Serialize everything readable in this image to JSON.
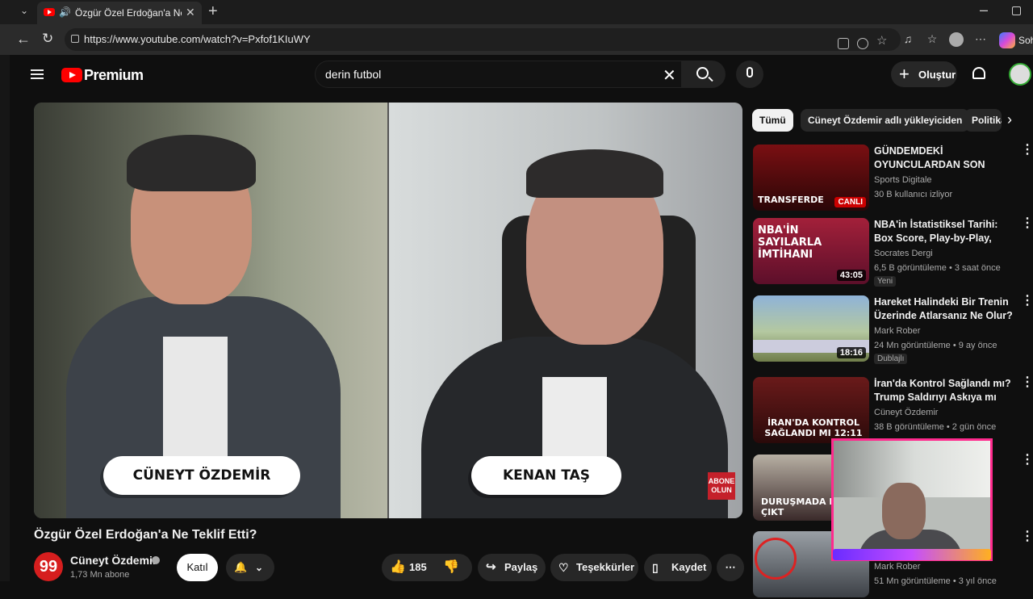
{
  "browser": {
    "tab_title": "Özgür Özel Erdoğan'a Ne Teklif Etti?",
    "url": "https://www.youtube.com/watch?v=Pxfof1KIuWY",
    "copilot_label": "Soh"
  },
  "header": {
    "brand": "Premium",
    "search_value": "derin futbol",
    "create_label": "Oluştur"
  },
  "video": {
    "name_left": "CÜNEYT ÖZDEMİR",
    "name_right": "KENAN TAŞ",
    "abone_badge": "ABONE OLUN",
    "title": "Özgür Özel Erdoğan'a Ne Teklif Etti?",
    "channel": "Cüneyt Özdemir",
    "channel_initial": "99",
    "subscribers": "1,73 Mn abone",
    "join_label": "Katıl",
    "like_count": "185",
    "share_label": "Paylaş",
    "thanks_label": "Teşekkürler",
    "save_label": "Kaydet"
  },
  "chips": [
    "Tümü",
    "Cüneyt Özdemir adlı yükleyiciden",
    "Politika"
  ],
  "recommendations": [
    {
      "title": "GÜNDEMDEKİ OYUNCULARDAN SON HABERLER | CANLI YAYI...",
      "channel": "Sports Digitale",
      "meta": "30 B kullanıcı izliyor",
      "duration": "",
      "live": "CANLI",
      "badge": "",
      "thumb_text": "TRANSFERDE"
    },
    {
      "title": "NBA'in İstatistiksel Tarihi: Box Score, Play-by-Play, Curry'nin ...",
      "channel": "Socrates Dergi",
      "meta": "6,5 B görüntüleme • 3 saat önce",
      "duration": "43:05",
      "live": "",
      "badge": "Yeni",
      "thumb_text": "NBA'İN SAYILARLA İMTİHANI"
    },
    {
      "title": "Hareket Halindeki Bir Trenin Üzerinde Atlarsanız Ne Olur?",
      "channel": "Mark Rober",
      "meta": "24 Mn görüntüleme • 9 ay önce",
      "duration": "18:16",
      "live": "",
      "badge": "Dublajlı",
      "thumb_text": ""
    },
    {
      "title": "İran'da Kontrol Sağlandı mı? Trump Saldırıyı Askıya mı Aldı?",
      "channel": "Cüneyt Özdemir",
      "meta": "38 B görüntüleme • 2 gün önce",
      "duration": "",
      "live": "",
      "badge": "",
      "thumb_text": "İRAN'DA KONTROL SAĞLANDI MI 12:11"
    },
    {
      "title": "",
      "channel": "",
      "meta": "",
      "duration": "",
      "live": "",
      "badge": "",
      "thumb_text": "DURUŞMADA NE ÇIKT"
    },
    {
      "title": "",
      "channel": "Mark Rober",
      "meta": "51 Mn görüntüleme • 3 yıl önce",
      "duration": "",
      "live": "",
      "badge": "",
      "thumb_text": ""
    }
  ]
}
